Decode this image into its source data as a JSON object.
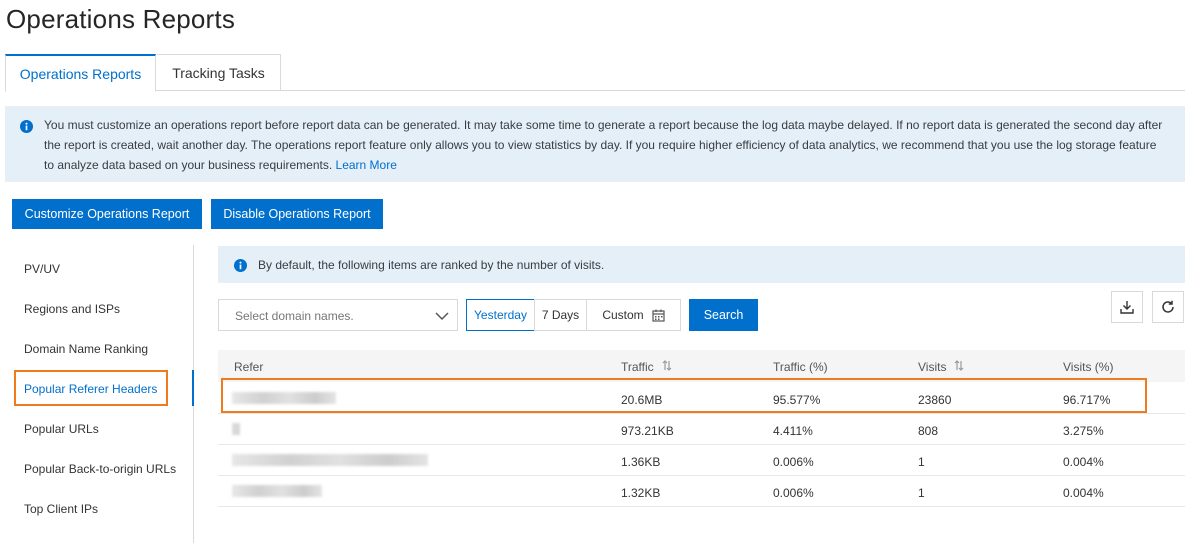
{
  "page": {
    "title": "Operations Reports"
  },
  "tabs": [
    {
      "label": "Operations Reports",
      "active": true
    },
    {
      "label": "Tracking Tasks",
      "active": false
    }
  ],
  "notice": {
    "text": "You must customize an operations report before report data can be generated. It may take some time to generate a report because the log data maybe delayed. If no report data is generated the second day after the report is created, wait another day. The operations report feature only allows you to view statistics by day. If you require higher efficiency of data analytics, we recommend that you use the log storage feature to analyze data based on your business requirements.",
    "link": "Learn More",
    "icon": "info-icon"
  },
  "actions": {
    "customize_label": "Customize Operations Report",
    "disable_label": "Disable Operations Report"
  },
  "sidebar": {
    "items": [
      {
        "label": "PV/UV"
      },
      {
        "label": "Regions and ISPs"
      },
      {
        "label": "Domain Name Ranking"
      },
      {
        "label": "Popular Referer Headers",
        "active": true
      },
      {
        "label": "Popular URLs"
      },
      {
        "label": "Popular Back-to-origin URLs"
      },
      {
        "label": "Top Client IPs"
      }
    ]
  },
  "inner_notice": {
    "text": "By default, the following items are ranked by the number of visits."
  },
  "filters": {
    "domain_placeholder": "Select domain names.",
    "ranges": [
      "Yesterday",
      "7 Days",
      "Custom"
    ],
    "selected_range": "Yesterday",
    "search_label": "Search"
  },
  "table": {
    "columns": [
      "Refer",
      "Traffic",
      "Traffic (%)",
      "Visits",
      "Visits (%)"
    ],
    "rows": [
      {
        "refer": "",
        "traffic": "20.6MB",
        "traffic_pct": "95.577%",
        "visits": "23860",
        "visits_pct": "96.717%"
      },
      {
        "refer": "",
        "traffic": "973.21KB",
        "traffic_pct": "4.411%",
        "visits": "808",
        "visits_pct": "3.275%"
      },
      {
        "refer": "",
        "traffic": "1.36KB",
        "traffic_pct": "0.006%",
        "visits": "1",
        "visits_pct": "0.004%"
      },
      {
        "refer": "",
        "traffic": "1.32KB",
        "traffic_pct": "0.006%",
        "visits": "1",
        "visits_pct": "0.004%"
      }
    ]
  },
  "colors": {
    "accent": "#0070cc",
    "highlight": "#f07b1c",
    "notice_bg": "#e5eff8"
  }
}
